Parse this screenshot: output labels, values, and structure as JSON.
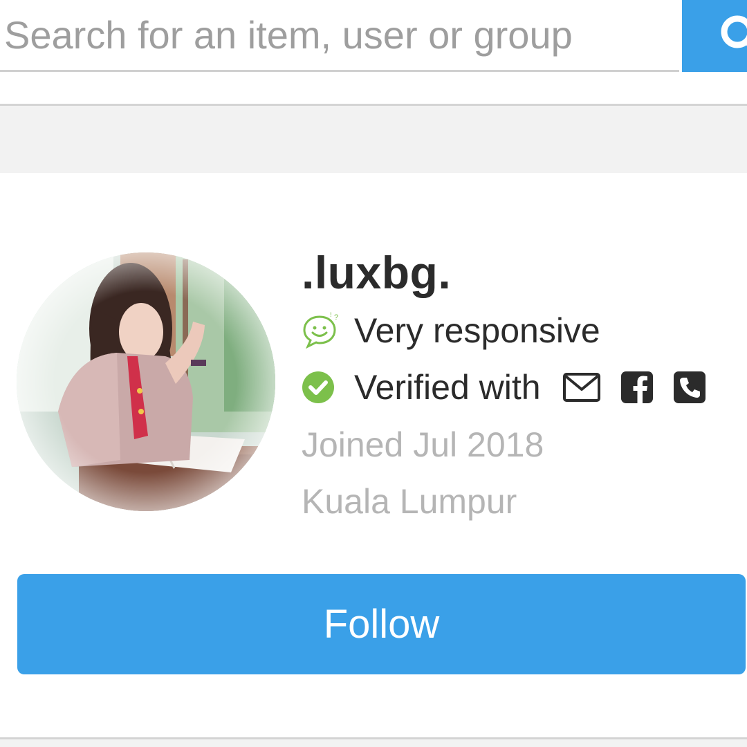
{
  "search": {
    "placeholder": "Search for an item, user or group",
    "button_icon": "search-icon"
  },
  "profile": {
    "username": ".luxbg.",
    "responsiveness": {
      "icon": "smiley-chat-icon",
      "label": "Very responsive"
    },
    "verification": {
      "icon": "check-circle-icon",
      "label": "Verified with",
      "methods": [
        "email-icon",
        "facebook-icon",
        "phone-icon"
      ]
    },
    "joined": "Joined Jul 2018",
    "location": "Kuala Lumpur",
    "avatar_icon": "profile-photo"
  },
  "actions": {
    "follow_label": "Follow"
  },
  "colors": {
    "accent": "#3aa0e8",
    "check_green": "#7cc04b",
    "text_dark": "#2b2b2b",
    "text_muted": "#b5b5b5",
    "band_gray": "#f2f2f2"
  }
}
